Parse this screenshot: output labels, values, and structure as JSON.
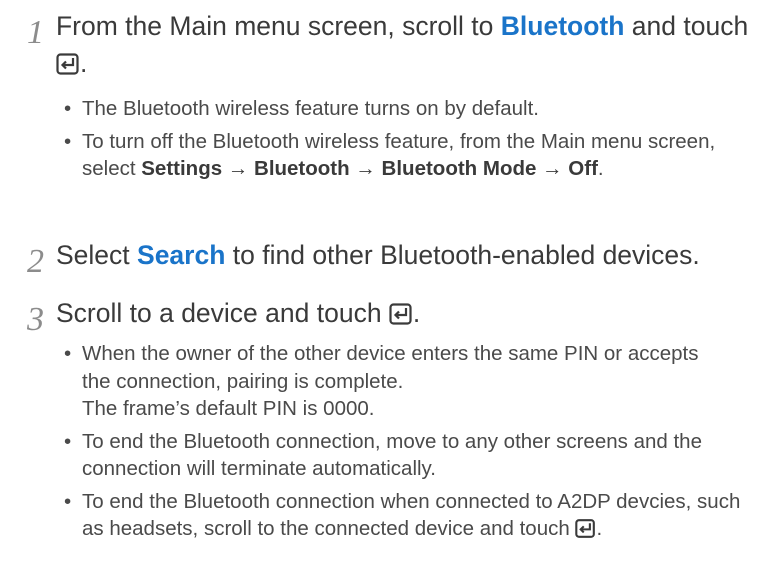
{
  "step1": {
    "number": "1",
    "text_before": "From the Main menu screen, scroll to ",
    "highlight": "Bluetooth",
    "text_after": " and touch",
    "end": ".",
    "bullets": [
      {
        "text": "The Bluetooth wireless feature turns on by default."
      },
      {
        "text_a": "To turn off the Bluetooth wireless feature, from the Main menu screen, select ",
        "bold": "Settings → Bluetooth → Bluetooth Mode → Off",
        "text_b": "."
      }
    ]
  },
  "step2": {
    "number": "2",
    "text_before": "Select ",
    "highlight": "Search",
    "text_after": " to find other Bluetooth-enabled devices."
  },
  "step3": {
    "number": "3",
    "text_before": "Scroll to a device and touch ",
    "end": ".",
    "bullets": [
      {
        "text": "When the owner of the other device enters the same PIN or accepts the connection, pairing is complete.",
        "text2": "The frame’s default PIN is 0000."
      },
      {
        "text": "To end the Bluetooth connection, move to any other screens and the connection will terminate automatically."
      },
      {
        "text_a": "To end the Bluetooth connection when connected to A2DP devcies, such as headsets, scroll to the connected device and touch ",
        "text_b": "."
      }
    ]
  },
  "icons": {
    "enter": "enter-key-icon"
  },
  "colors": {
    "highlight": "#1a74c9",
    "text": "#3a3a3a",
    "number": "#8c8c8c"
  }
}
